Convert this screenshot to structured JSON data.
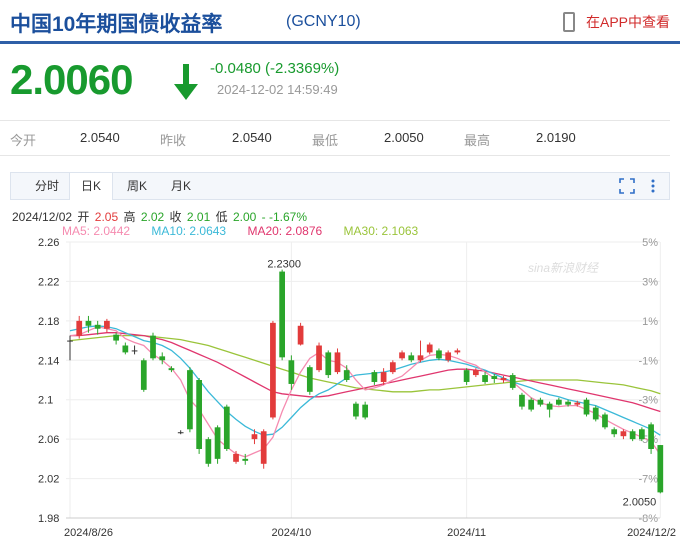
{
  "header": {
    "title": "中国10年期国债收益率",
    "code": "(GCNY10)",
    "app_link": "在APP中查看"
  },
  "quote": {
    "price": "2.0060",
    "change": "-0.0480 (-2.3369%)",
    "time": "2024-12-02 14:59:49",
    "color": "#189a2e"
  },
  "stats": [
    {
      "label": "今开",
      "value": "2.0540"
    },
    {
      "label": "昨收",
      "value": "2.0540"
    },
    {
      "label": "最低",
      "value": "2.0050"
    },
    {
      "label": "最高",
      "value": "2.0190"
    }
  ],
  "tabs": [
    "分时",
    "日K",
    "周K",
    "月K"
  ],
  "active_tab": "日K",
  "info_line": {
    "date": "2024/12/02",
    "open_label": "开",
    "open": "2.05",
    "high_label": "高",
    "high": "2.02",
    "close_label": "收",
    "close": "2.01",
    "low_label": "低",
    "low": "2.00",
    "change": "- -1.67%"
  },
  "ma_line": {
    "ma5": "MA5: 2.0442",
    "ma10": "MA10: 2.0643",
    "ma20": "MA20: 2.0876",
    "ma30": "MA30: 2.1063"
  },
  "watermark": "sina新浪财经",
  "chart_data": {
    "type": "candlestick",
    "y_ticks": [
      "2.26",
      "2.22",
      "2.18",
      "2.14",
      "2.1",
      "2.06",
      "2.02",
      "1.98"
    ],
    "y_range": [
      1.98,
      2.26
    ],
    "right_ticks": [
      "5%",
      "3%",
      "1%",
      "-1%",
      "-3%",
      "-5%",
      "-7%",
      "-8%"
    ],
    "x_ticks": [
      "2024/8/26",
      "2024/10",
      "2024/11",
      "2024/12/2"
    ],
    "x_tick_index": [
      0,
      24,
      43,
      64
    ],
    "up_color": "#e23b3b",
    "down_color": "#2aa52a",
    "high_label": "2.2300",
    "high_label_index": 23,
    "low_label": "2.0050",
    "low_label_index": 64,
    "candles": [
      {
        "o": 2.16,
        "c": 2.16,
        "h": 2.165,
        "l": 2.14
      },
      {
        "o": 2.165,
        "c": 2.18,
        "h": 2.185,
        "l": 2.162
      },
      {
        "o": 2.18,
        "c": 2.175,
        "h": 2.185,
        "l": 2.168
      },
      {
        "o": 2.176,
        "c": 2.172,
        "h": 2.18,
        "l": 2.166
      },
      {
        "o": 2.172,
        "c": 2.18,
        "h": 2.182,
        "l": 2.168
      },
      {
        "o": 2.166,
        "c": 2.16,
        "h": 2.168,
        "l": 2.156
      },
      {
        "o": 2.155,
        "c": 2.148,
        "h": 2.158,
        "l": 2.146
      },
      {
        "o": 2.15,
        "c": 2.15,
        "h": 2.155,
        "l": 2.146
      },
      {
        "o": 2.14,
        "c": 2.11,
        "h": 2.142,
        "l": 2.108
      },
      {
        "o": 2.165,
        "c": 2.142,
        "h": 2.168,
        "l": 2.14
      },
      {
        "o": 2.144,
        "c": 2.14,
        "h": 2.148,
        "l": 2.136
      },
      {
        "o": 2.132,
        "c": 2.13,
        "h": 2.134,
        "l": 2.128
      },
      {
        "o": 2.067,
        "c": 2.067,
        "h": 2.069,
        "l": 2.065
      },
      {
        "o": 2.13,
        "c": 2.07,
        "h": 2.133,
        "l": 2.067
      },
      {
        "o": 2.12,
        "c": 2.05,
        "h": 2.122,
        "l": 2.045
      },
      {
        "o": 2.06,
        "c": 2.035,
        "h": 2.062,
        "l": 2.032
      },
      {
        "o": 2.072,
        "c": 2.04,
        "h": 2.074,
        "l": 2.035
      },
      {
        "o": 2.093,
        "c": 2.05,
        "h": 2.095,
        "l": 2.048
      },
      {
        "o": 2.037,
        "c": 2.045,
        "h": 2.048,
        "l": 2.035
      },
      {
        "o": 2.04,
        "c": 2.038,
        "h": 2.045,
        "l": 2.034
      },
      {
        "o": 2.06,
        "c": 2.065,
        "h": 2.07,
        "l": 2.055
      },
      {
        "o": 2.035,
        "c": 2.068,
        "h": 2.07,
        "l": 2.03
      },
      {
        "o": 2.082,
        "c": 2.178,
        "h": 2.18,
        "l": 2.08
      },
      {
        "o": 2.23,
        "c": 2.143,
        "h": 2.232,
        "l": 2.14
      },
      {
        "o": 2.14,
        "c": 2.116,
        "h": 2.145,
        "l": 2.11
      },
      {
        "o": 2.156,
        "c": 2.175,
        "h": 2.178,
        "l": 2.155
      },
      {
        "o": 2.133,
        "c": 2.108,
        "h": 2.135,
        "l": 2.105
      },
      {
        "o": 2.13,
        "c": 2.155,
        "h": 2.158,
        "l": 2.128
      },
      {
        "o": 2.148,
        "c": 2.125,
        "h": 2.15,
        "l": 2.122
      },
      {
        "o": 2.128,
        "c": 2.148,
        "h": 2.152,
        "l": 2.126
      },
      {
        "o": 2.13,
        "c": 2.12,
        "h": 2.135,
        "l": 2.118
      },
      {
        "o": 2.096,
        "c": 2.083,
        "h": 2.098,
        "l": 2.08
      },
      {
        "o": 2.095,
        "c": 2.082,
        "h": 2.098,
        "l": 2.08
      },
      {
        "o": 2.128,
        "c": 2.118,
        "h": 2.13,
        "l": 2.115
      },
      {
        "o": 2.118,
        "c": 2.128,
        "h": 2.132,
        "l": 2.115
      },
      {
        "o": 2.128,
        "c": 2.138,
        "h": 2.14,
        "l": 2.126
      },
      {
        "o": 2.142,
        "c": 2.148,
        "h": 2.15,
        "l": 2.14
      },
      {
        "o": 2.145,
        "c": 2.14,
        "h": 2.148,
        "l": 2.138
      },
      {
        "o": 2.14,
        "c": 2.145,
        "h": 2.16,
        "l": 2.138
      },
      {
        "o": 2.148,
        "c": 2.156,
        "h": 2.158,
        "l": 2.146
      },
      {
        "o": 2.15,
        "c": 2.142,
        "h": 2.152,
        "l": 2.14
      },
      {
        "o": 2.14,
        "c": 2.148,
        "h": 2.15,
        "l": 2.138
      },
      {
        "o": 2.148,
        "c": 2.15,
        "h": 2.152,
        "l": 2.146
      },
      {
        "o": 2.13,
        "c": 2.118,
        "h": 2.132,
        "l": 2.115
      },
      {
        "o": 2.125,
        "c": 2.13,
        "h": 2.132,
        "l": 2.123
      },
      {
        "o": 2.125,
        "c": 2.118,
        "h": 2.128,
        "l": 2.116
      },
      {
        "o": 2.124,
        "c": 2.121,
        "h": 2.126,
        "l": 2.117
      },
      {
        "o": 2.12,
        "c": 2.122,
        "h": 2.124,
        "l": 2.117
      },
      {
        "o": 2.125,
        "c": 2.112,
        "h": 2.127,
        "l": 2.11
      },
      {
        "o": 2.105,
        "c": 2.093,
        "h": 2.107,
        "l": 2.09
      },
      {
        "o": 2.1,
        "c": 2.09,
        "h": 2.102,
        "l": 2.088
      },
      {
        "o": 2.1,
        "c": 2.095,
        "h": 2.102,
        "l": 2.093
      },
      {
        "o": 2.096,
        "c": 2.09,
        "h": 2.098,
        "l": 2.082
      },
      {
        "o": 2.1,
        "c": 2.095,
        "h": 2.102,
        "l": 2.094
      },
      {
        "o": 2.098,
        "c": 2.095,
        "h": 2.1,
        "l": 2.093
      },
      {
        "o": 2.095,
        "c": 2.097,
        "h": 2.099,
        "l": 2.093
      },
      {
        "o": 2.1,
        "c": 2.085,
        "h": 2.102,
        "l": 2.083
      },
      {
        "o": 2.092,
        "c": 2.08,
        "h": 2.094,
        "l": 2.078
      },
      {
        "o": 2.085,
        "c": 2.072,
        "h": 2.087,
        "l": 2.07
      },
      {
        "o": 2.07,
        "c": 2.065,
        "h": 2.072,
        "l": 2.062
      },
      {
        "o": 2.063,
        "c": 2.068,
        "h": 2.07,
        "l": 2.06
      },
      {
        "o": 2.068,
        "c": 2.06,
        "h": 2.07,
        "l": 2.058
      },
      {
        "o": 2.07,
        "c": 2.06,
        "h": 2.072,
        "l": 2.058
      },
      {
        "o": 2.075,
        "c": 2.05,
        "h": 2.077,
        "l": 2.045
      },
      {
        "o": 2.054,
        "c": 2.006,
        "h": 2.054,
        "l": 2.005
      }
    ],
    "ma5": [
      2.165,
      2.166,
      2.17,
      2.174,
      2.172,
      2.17,
      2.162,
      2.158,
      2.155,
      2.146,
      2.14,
      2.132,
      2.12,
      2.1,
      2.09,
      2.075,
      2.06,
      2.052,
      2.045,
      2.042,
      2.046,
      2.05,
      2.062,
      2.088,
      2.11,
      2.128,
      2.142,
      2.148,
      2.14,
      2.138,
      2.132,
      2.12,
      2.11,
      2.112,
      2.115,
      2.12,
      2.124,
      2.132,
      2.14,
      2.145,
      2.146,
      2.145,
      2.142,
      2.138,
      2.135,
      2.128,
      2.122,
      2.12,
      2.118,
      2.11,
      2.102,
      2.097,
      2.094,
      2.093,
      2.094,
      2.094,
      2.09,
      2.086,
      2.08,
      2.075,
      2.07,
      2.066,
      2.062,
      2.058,
      2.044
    ],
    "ma10": [
      2.17,
      2.172,
      2.174,
      2.175,
      2.174,
      2.172,
      2.168,
      2.164,
      2.16,
      2.158,
      2.155,
      2.15,
      2.142,
      2.132,
      2.12,
      2.108,
      2.098,
      2.088,
      2.08,
      2.073,
      2.068,
      2.064,
      2.065,
      2.072,
      2.082,
      2.092,
      2.1,
      2.106,
      2.11,
      2.116,
      2.122,
      2.125,
      2.126,
      2.127,
      2.128,
      2.13,
      2.133,
      2.136,
      2.138,
      2.14,
      2.141,
      2.14,
      2.138,
      2.136,
      2.133,
      2.13,
      2.126,
      2.122,
      2.118,
      2.115,
      2.112,
      2.108,
      2.105,
      2.103,
      2.1,
      2.098,
      2.096,
      2.094,
      2.09,
      2.086,
      2.082,
      2.078,
      2.074,
      2.07,
      2.064
    ],
    "ma20": [
      2.165,
      2.165,
      2.166,
      2.167,
      2.168,
      2.168,
      2.167,
      2.166,
      2.165,
      2.163,
      2.161,
      2.158,
      2.154,
      2.15,
      2.146,
      2.142,
      2.138,
      2.133,
      2.128,
      2.123,
      2.118,
      2.113,
      2.108,
      2.106,
      2.105,
      2.104,
      2.103,
      2.103,
      2.104,
      2.106,
      2.108,
      2.11,
      2.112,
      2.114,
      2.116,
      2.118,
      2.12,
      2.122,
      2.124,
      2.126,
      2.128,
      2.13,
      2.131,
      2.131,
      2.13,
      2.129,
      2.127,
      2.125,
      2.123,
      2.121,
      2.119,
      2.117,
      2.115,
      2.113,
      2.111,
      2.109,
      2.107,
      2.105,
      2.103,
      2.101,
      2.099,
      2.097,
      2.094,
      2.091,
      2.088
    ],
    "ma30": [
      2.16,
      2.161,
      2.162,
      2.163,
      2.164,
      2.165,
      2.165,
      2.165,
      2.165,
      2.164,
      2.163,
      2.162,
      2.161,
      2.159,
      2.157,
      2.155,
      2.152,
      2.149,
      2.146,
      2.143,
      2.14,
      2.137,
      2.134,
      2.131,
      2.128,
      2.125,
      2.122,
      2.12,
      2.118,
      2.116,
      2.114,
      2.112,
      2.111,
      2.11,
      2.109,
      2.108,
      2.108,
      2.108,
      2.109,
      2.11,
      2.11,
      2.111,
      2.112,
      2.113,
      2.114,
      2.115,
      2.116,
      2.117,
      2.118,
      2.119,
      2.12,
      2.12,
      2.12,
      2.12,
      2.12,
      2.12,
      2.119,
      2.118,
      2.117,
      2.116,
      2.115,
      2.113,
      2.111,
      2.109,
      2.106
    ],
    "ma_colors": {
      "ma5": "#f58bb0",
      "ma10": "#3bb9d8",
      "ma20": "#e0366e",
      "ma30": "#9ac43a"
    }
  }
}
